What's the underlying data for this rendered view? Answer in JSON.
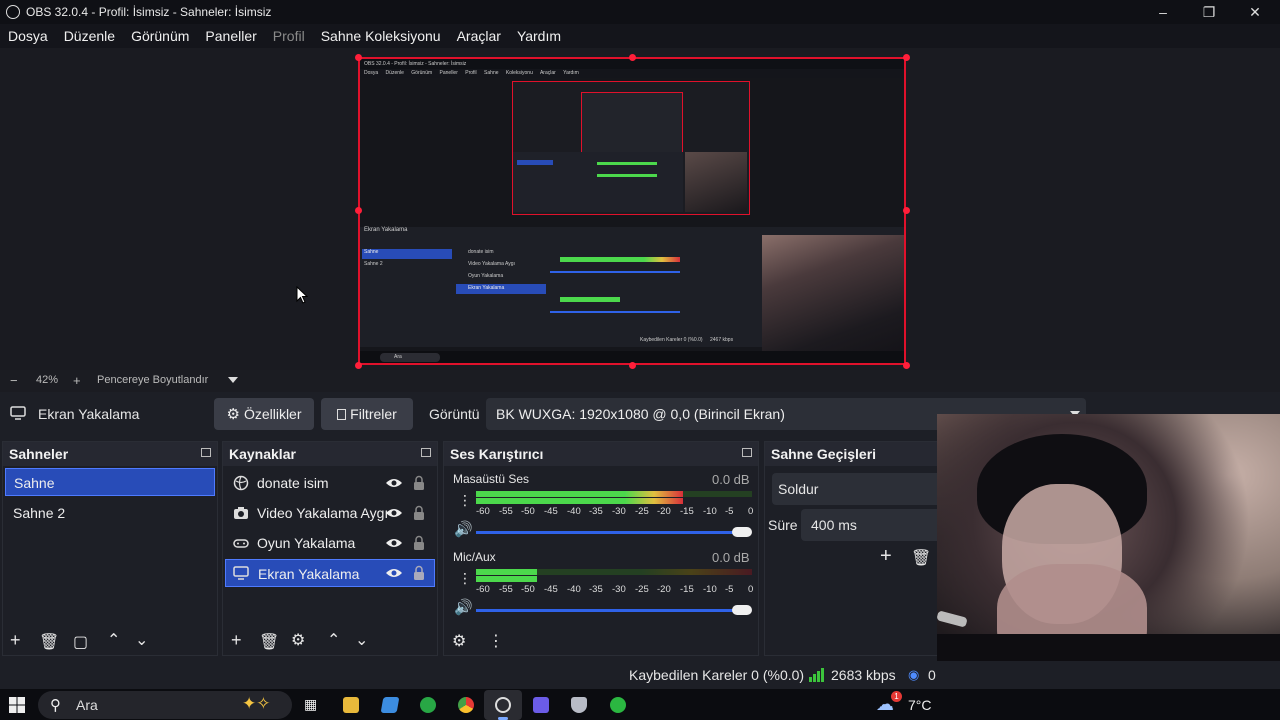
{
  "window": {
    "title": "OBS 32.0.4 - Profil: İsimsiz - Sahneler: İsimsiz"
  },
  "menu": {
    "items": [
      "Dosya",
      "Düzenle",
      "Görünüm",
      "Paneller",
      "Profil",
      "Sahne Koleksiyonu",
      "Araçlar",
      "Yardım"
    ]
  },
  "preview_mock": {
    "title": "OBS 32.0.4 - Profil: İsimsiz - Sahneler: İsimsiz",
    "menu": "Dosya Düzenle Görünüm Paneller Profil Sahne Koleksiyonu Araçlar Yardım",
    "source": "Ekran Yakalama",
    "scenes": [
      "Sahne",
      "Sahne 2"
    ],
    "sources": [
      "donate isim",
      "Video Yakalama Aygı",
      "Oyun Yakalama",
      "Ekran Yakalama"
    ],
    "status": "Kaybedilen Kareler 0 (%0.0)",
    "kbps": "2467 kbps",
    "taskbar_search": "Ara"
  },
  "zoom": {
    "minus": "−",
    "value": "42%",
    "plus": "+",
    "fit_label": "Pencereye Boyutlandır"
  },
  "context": {
    "source_name": "Ekran Yakalama",
    "properties_label": "Özellikler",
    "filters_label": "Filtreler",
    "display_label": "Görüntü",
    "display_value": "BK WUXGA: 1920x1080 @ 0,0 (Birincil Ekran)"
  },
  "scenes": {
    "header": "Sahneler",
    "items": [
      {
        "label": "Sahne",
        "selected": true
      },
      {
        "label": "Sahne 2",
        "selected": false
      }
    ]
  },
  "sources": {
    "header": "Kaynaklar",
    "items": [
      {
        "label": "donate isim",
        "icon": "globe-icon",
        "selected": false
      },
      {
        "label": "Video Yakalama Aygı",
        "icon": "camera-icon",
        "selected": false
      },
      {
        "label": "Oyun Yakalama",
        "icon": "gamepad-icon",
        "selected": false
      },
      {
        "label": "Ekran Yakalama",
        "icon": "monitor-icon",
        "selected": true
      }
    ]
  },
  "mixer": {
    "header": "Ses Karıştırıcı",
    "channels": [
      {
        "name": "Masaüstü Ses",
        "db": "0.0 dB",
        "level": 0.75
      },
      {
        "name": "Mic/Aux",
        "db": "0.0 dB",
        "level": 0.22
      }
    ],
    "ticks": [
      "-60",
      "-55",
      "-50",
      "-45",
      "-40",
      "-35",
      "-30",
      "-25",
      "-20",
      "-15",
      "-10",
      "-5",
      "0"
    ]
  },
  "transitions": {
    "header": "Sahne Geçişleri",
    "selected": "Soldur",
    "duration_label": "Süre",
    "duration_value": "400 ms"
  },
  "status": {
    "dropped_frames": "Kaybedilen Kareler 0 (%0.0)",
    "bitrate": "2683 kbps",
    "extra": "0"
  },
  "taskbar": {
    "search_placeholder": "Ara",
    "weather_temp": "7°C",
    "weather_badge": "1"
  },
  "colors": {
    "selection_blue": "#284cb8",
    "preview_border_red": "#e0112b",
    "meter_green": "#4cd84c",
    "meter_yellow": "#e0c040",
    "meter_red": "#d8303a"
  }
}
